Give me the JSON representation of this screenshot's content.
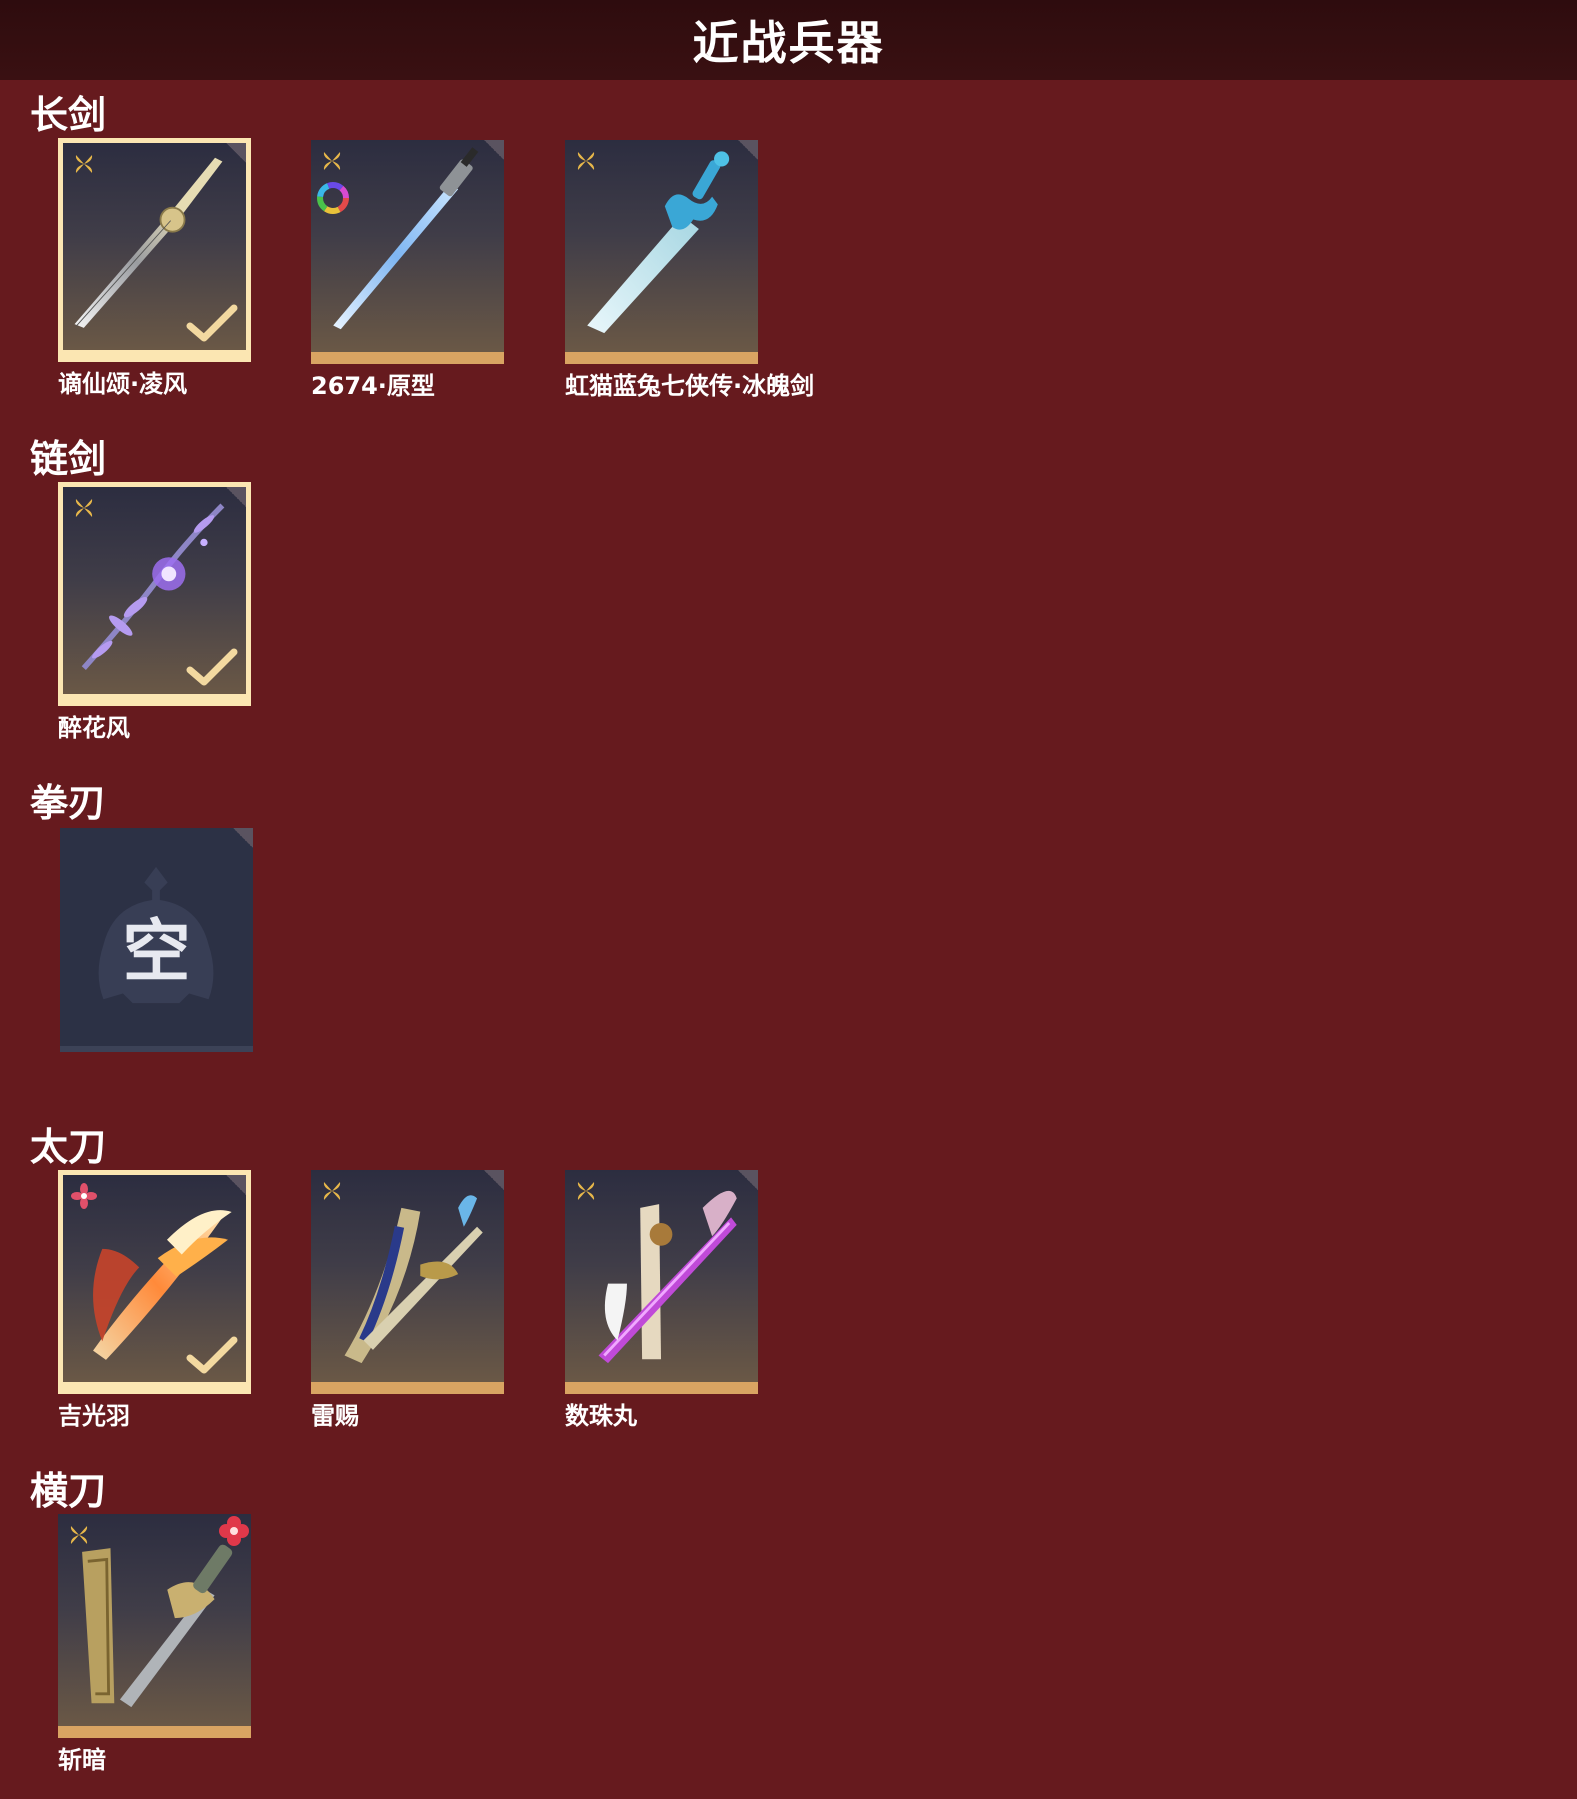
{
  "header": {
    "title": "近战兵器"
  },
  "colors": {
    "background": "#661a1e",
    "header_bar": "#2e0c0e",
    "card_bottom_accent": "#d9a462",
    "selected_border": "#fbe6b2",
    "empty_slot": "#2c3145"
  },
  "sections": [
    {
      "title": "长剑",
      "items": [
        {
          "name": "谪仙颂·凌风",
          "rarity_icon": "gold-flower-icon",
          "equipped": true
        },
        {
          "name": "2674·原型",
          "rarity_icon": "gold-flower-icon",
          "extra_icon": "color-wheel-icon",
          "equipped": false
        },
        {
          "name": "虹猫蓝兔七侠传·冰魄剑",
          "rarity_icon": "gold-flower-icon",
          "equipped": false
        }
      ]
    },
    {
      "title": "链剑",
      "items": [
        {
          "name": "醉花风",
          "rarity_icon": "gold-flower-icon",
          "equipped": true
        }
      ]
    },
    {
      "title": "拳刃",
      "items": [
        {
          "name": "",
          "empty_label": "空",
          "empty": true
        }
      ]
    },
    {
      "title": "太刀",
      "items": [
        {
          "name": "吉光羽",
          "rarity_icon": "red-flower-icon",
          "equipped": true
        },
        {
          "name": "雷赐",
          "rarity_icon": "gold-flower-icon",
          "equipped": false
        },
        {
          "name": "数珠丸",
          "rarity_icon": "gold-flower-icon",
          "equipped": false
        }
      ]
    },
    {
      "title": "横刀",
      "items": [
        {
          "name": "斩暗",
          "rarity_icon": "gold-flower-icon",
          "corner_badge": "red-clover-badge-icon",
          "equipped": false
        }
      ]
    }
  ]
}
